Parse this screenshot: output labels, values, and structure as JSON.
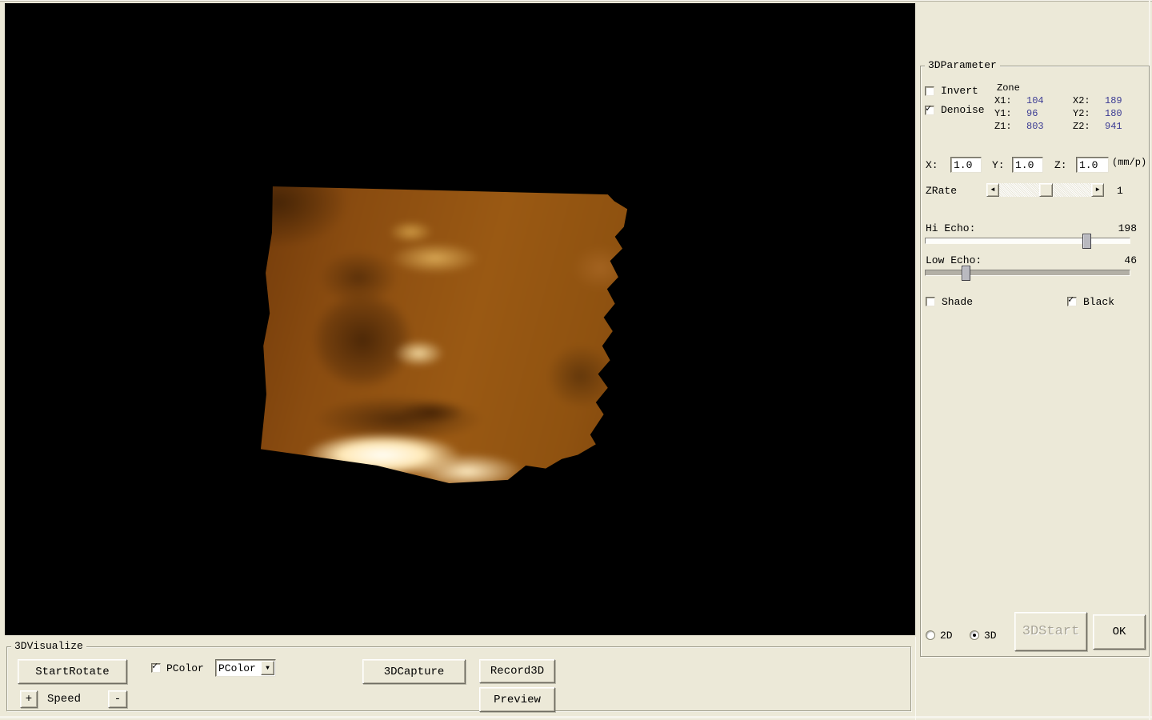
{
  "colors": {
    "background": "#ece9d8",
    "value_blue": "#3b3b94",
    "viewport_black": "#000000",
    "render_amber": "#9a5913"
  },
  "icons": {
    "check": "✓",
    "dropdown_arrow": "▼",
    "scroll_left": "◄",
    "scroll_right": "►"
  },
  "param_panel": {
    "title": "3DParameter",
    "invert_label": "Invert",
    "denoise_label": "Denoise",
    "zone": {
      "title": "Zone",
      "x1_label": "X1:",
      "x1": "104",
      "x2_label": "X2:",
      "x2": "189",
      "y1_label": "Y1:",
      "y1": "96",
      "y2_label": "Y2:",
      "y2": "180",
      "z1_label": "Z1:",
      "z1": "803",
      "z2_label": "Z2:",
      "z2": "941"
    },
    "scale": {
      "x_label": "X:",
      "x": "1.0",
      "y_label": "Y:",
      "y": "1.0",
      "z_label": "Z:",
      "z": "1.0",
      "unit": "(mm/p)"
    },
    "zrate": {
      "label": "ZRate",
      "value": "1"
    },
    "hi_echo": {
      "label": "Hi Echo:",
      "value": "198"
    },
    "low_echo": {
      "label": "Low Echo:",
      "value": "46"
    },
    "shade_label": "Shade",
    "black_label": "Black",
    "mode_2d_label": "2D",
    "mode_3d_label": "3D",
    "start3d_label": "3DStart",
    "ok_label": "OK"
  },
  "visualize_panel": {
    "title": "3DVisualize",
    "start_rotate_label": "StartRotate",
    "speed_plus_label": "+",
    "speed_label": "Speed",
    "speed_minus_label": "-",
    "pcolor_checkbox_label": "PColor",
    "pcolor_dropdown_value": "PColor",
    "capture_label": "3DCapture",
    "record_label": "Record3D",
    "preview_label": "Preview"
  }
}
